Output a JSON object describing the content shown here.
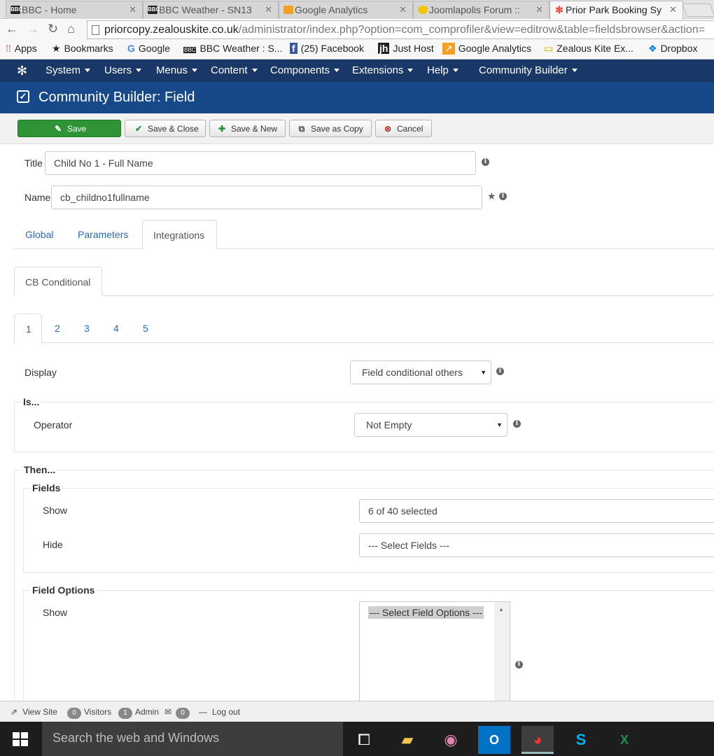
{
  "browser": {
    "tabs": [
      {
        "label": "BBC - Home",
        "icon": "bbc-icon"
      },
      {
        "label": "BBC Weather - SN13",
        "icon": "bbc-icon"
      },
      {
        "label": "Google Analytics",
        "icon": "analytics-icon"
      },
      {
        "label": "Joomlapolis Forum ::",
        "icon": "joomlapolis-icon"
      },
      {
        "label": "Prior Park Booking Sy",
        "icon": "joomla-icon"
      }
    ],
    "url_host": "priorcopy.zealouskite.co.uk",
    "url_path": "/administrator/index.php?option=com_comprofiler&view=editrow&table=fieldsbrowser&action=",
    "bookmarks": [
      "Apps",
      "Bookmarks",
      "Google",
      "BBC Weather : S...",
      "(25) Facebook",
      "Just Host",
      "Google Analytics",
      "Zealous Kite Ex...",
      "Dropbox"
    ]
  },
  "admin_menu": [
    "System",
    "Users",
    "Menus",
    "Content",
    "Components",
    "Extensions",
    "Help",
    "Community Builder"
  ],
  "page_title": "Community Builder: Field",
  "toolbar": {
    "save": "Save",
    "save_close": "Save & Close",
    "save_new": "Save & New",
    "save_copy": "Save as Copy",
    "cancel": "Cancel"
  },
  "form": {
    "title_label": "Title",
    "title_value": "Child No 1 - Full Name",
    "name_label": "Name",
    "name_value": "cb_childno1fullname"
  },
  "main_tabs": [
    "Global",
    "Parameters",
    "Integrations"
  ],
  "integration_tab": "CB Conditional",
  "condition_tabs": [
    "1",
    "2",
    "3",
    "4",
    "5"
  ],
  "conditional": {
    "display_label": "Display",
    "display_value": "Field conditional others",
    "is_legend": "Is...",
    "operator_label": "Operator",
    "operator_value": "Not Empty",
    "then_legend": "Then...",
    "fields_legend": "Fields",
    "show_label": "Show",
    "show_value": "6 of 40 selected",
    "hide_label": "Hide",
    "hide_value": "--- Select Fields ---",
    "field_options_legend": "Field Options",
    "options_show_label": "Show",
    "options_show_value": "--- Select Field Options ---"
  },
  "status": {
    "view_site": "View Site",
    "visitors_count": "0",
    "visitors": "Visitors",
    "admin_count": "1",
    "admin": "Admin",
    "messages_count": "0",
    "logout": "Log out"
  },
  "taskbar": {
    "search": "Search the web and Windows"
  },
  "colors": {
    "nav": "#1a3867",
    "header": "#17498a",
    "save": "#2f9435",
    "link": "#2a69b8"
  }
}
